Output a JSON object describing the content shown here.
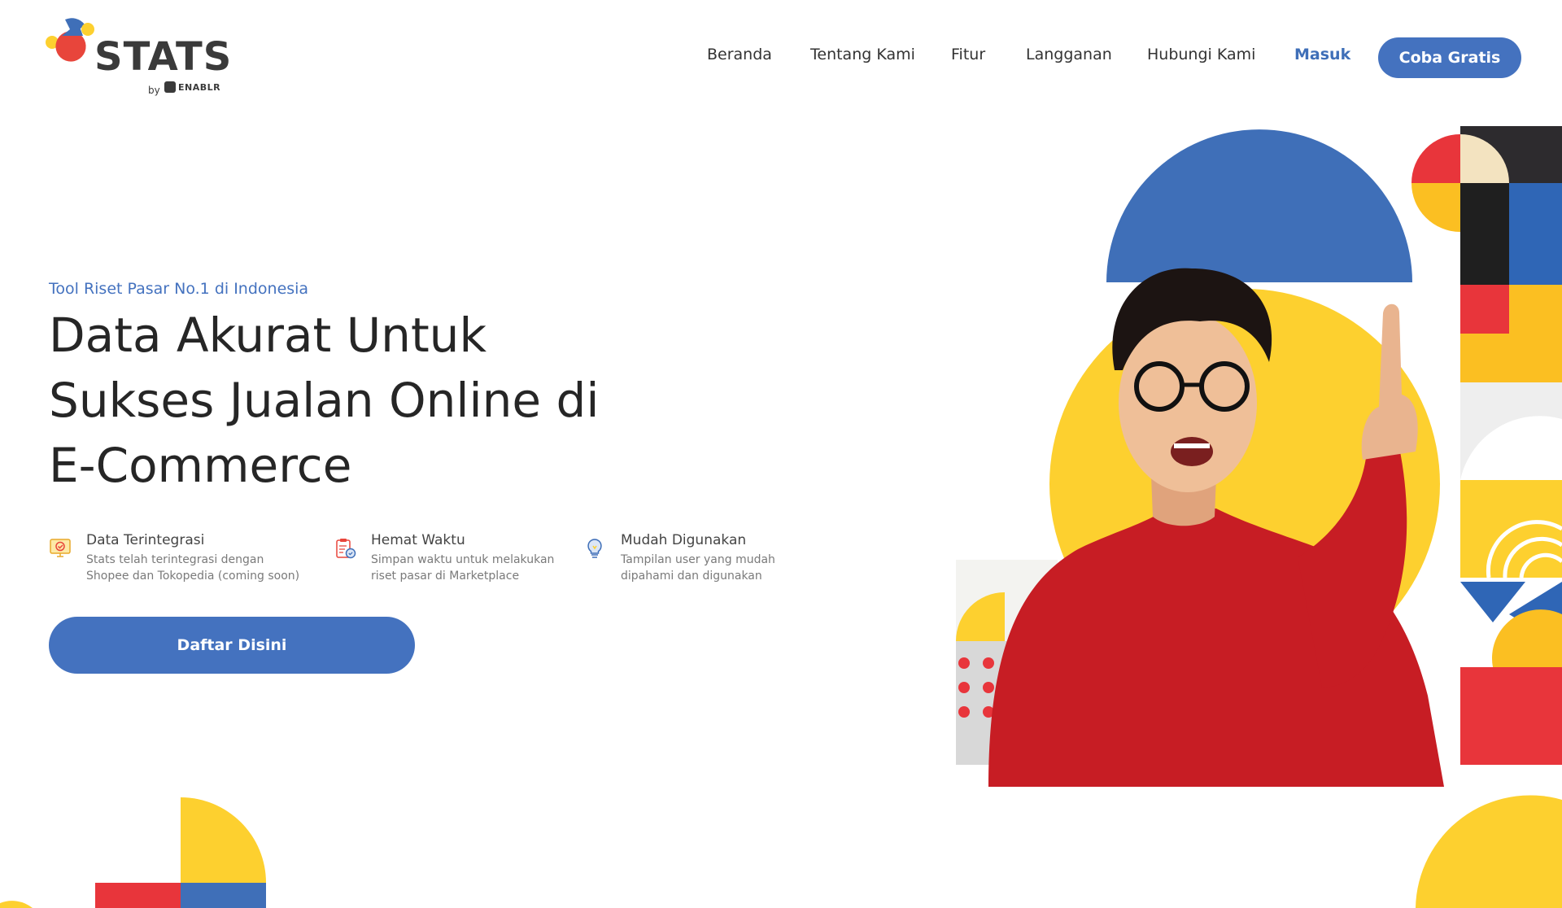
{
  "brand": {
    "name": "STATS",
    "by": "by",
    "partner": "ENABLR"
  },
  "nav": {
    "items": [
      "Beranda",
      "Tentang Kami",
      "Fitur",
      "Langganan",
      "Hubungi Kami"
    ],
    "login": "Masuk",
    "cta": "Coba Gratis"
  },
  "hero": {
    "tagline": "Tool Riset Pasar No.1 di Indonesia",
    "headline": [
      "Data Akurat Untuk",
      "Sukses Jualan Online di",
      "E-Commerce"
    ],
    "features": [
      {
        "icon": "monitor-check-icon",
        "title": "Data Terintegrasi",
        "desc": [
          "Stats telah terintegrasi dengan",
          "Shopee dan Tokopedia (coming soon)"
        ]
      },
      {
        "icon": "clipboard-clock-icon",
        "title": "Hemat Waktu",
        "desc": [
          "Simpan waktu untuk melakukan",
          "riset pasar di Marketplace"
        ]
      },
      {
        "icon": "lightbulb-icon",
        "title": "Mudah Digunakan",
        "desc": [
          "Tampilan user yang mudah",
          "dipahami dan digunakan"
        ]
      }
    ],
    "cta": "Daftar Disini"
  },
  "colors": {
    "primary": "#4472bf",
    "yellow": "#fdd02f",
    "red": "#e8353b",
    "dark": "#2b2b2b"
  }
}
